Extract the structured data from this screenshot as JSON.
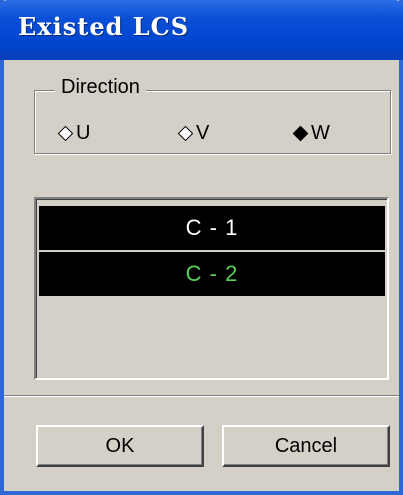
{
  "window": {
    "title": "Existed LCS"
  },
  "direction": {
    "legend": "Direction",
    "options": [
      {
        "label": "U",
        "selected": false
      },
      {
        "label": "V",
        "selected": false
      },
      {
        "label": "W",
        "selected": true
      }
    ]
  },
  "list": {
    "items": [
      {
        "label": "C - 1",
        "color": "#ffffff"
      },
      {
        "label": "C - 2",
        "color": "#55d155"
      }
    ]
  },
  "buttons": {
    "ok": "OK",
    "cancel": "Cancel"
  },
  "colors": {
    "titlebar": "#0046cf",
    "dialog": "#d4d0c8",
    "list_item_bg": "#000000"
  }
}
